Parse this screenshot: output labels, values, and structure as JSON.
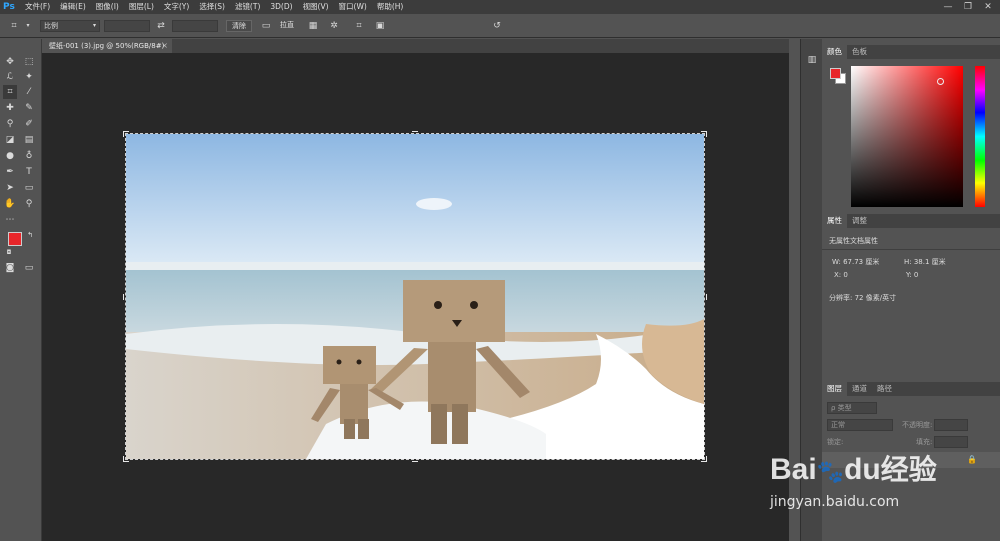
{
  "app": {
    "logo": "Ps"
  },
  "menu": [
    "文件(F)",
    "编辑(E)",
    "图像(I)",
    "图层(L)",
    "文字(Y)",
    "选择(S)",
    "滤镜(T)",
    "3D(D)",
    "视图(V)",
    "窗口(W)",
    "帮助(H)"
  ],
  "window_controls": {
    "minimize": "—",
    "restore": "❐",
    "close": "✕"
  },
  "options": {
    "ratio_label": "比例",
    "clear_label": "清除",
    "straighten_label": "拉直"
  },
  "document": {
    "tab_title": "壁纸-001 (3).jpg @ 50%(RGB/8#)",
    "close": "×"
  },
  "panels": {
    "color_tabs": [
      "颜色",
      "色板"
    ],
    "props_tabs": [
      "属性",
      "调整"
    ],
    "props_title": "无属性文档属性",
    "width": "W: 67.73 厘米",
    "height": "H: 38.1 厘米",
    "x": "X: 0",
    "y": "Y: 0",
    "resolution": "分辨率: 72 像素/英寸",
    "layers_tabs": [
      "图层",
      "通道",
      "路径"
    ],
    "layers_kind": "ρ 类型",
    "blend_mode": "正常",
    "opacity_label": "不透明度:",
    "lock_label": "锁定:",
    "fill_label": "填充:"
  },
  "colors": {
    "foreground": "#e8262a",
    "background": "#ffffff",
    "accent": "#2fa7ff"
  },
  "watermark": {
    "brand_a": "Bai",
    "brand_b": "du",
    "brand_cn": "经验",
    "url": "jingyan.baidu.com"
  }
}
